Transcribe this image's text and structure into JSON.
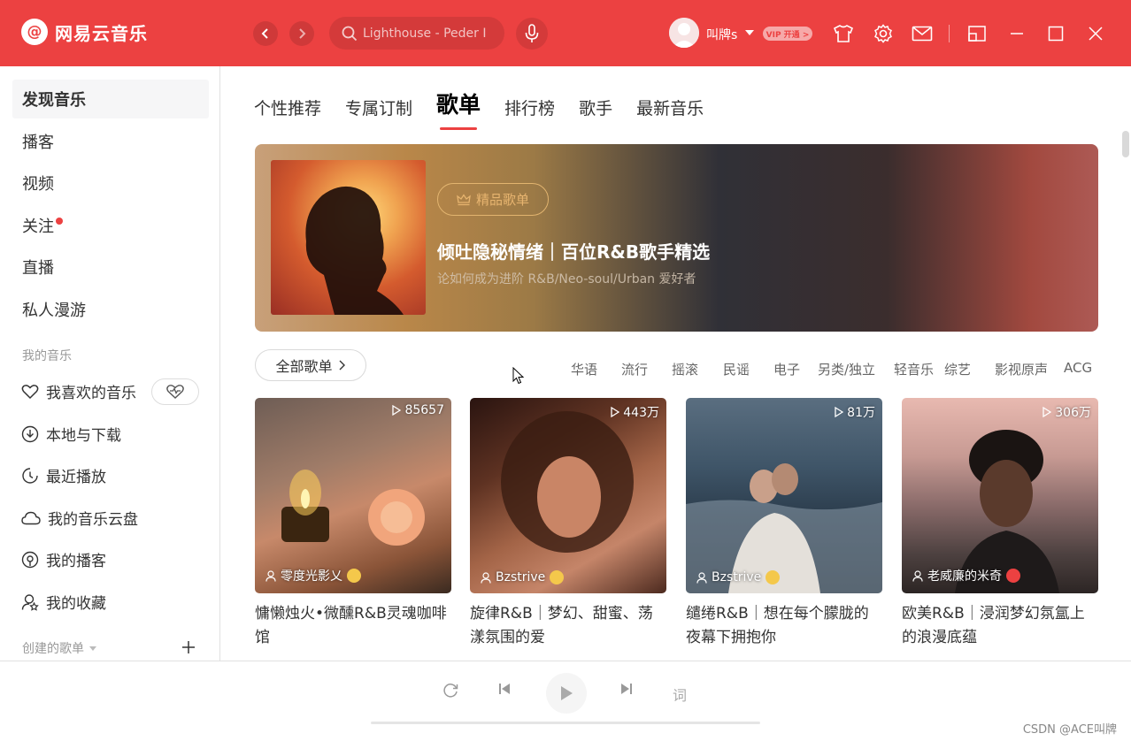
{
  "app": {
    "logo_text": "网易云音乐",
    "logo_mark": "@"
  },
  "header": {
    "search_placeholder": "Lighthouse - Peder I",
    "username": "叫牌s",
    "vip_label": "VIP 开通 >"
  },
  "sidebar": {
    "primary": [
      {
        "label": "发现音乐",
        "active": true
      },
      {
        "label": "播客"
      },
      {
        "label": "视频"
      },
      {
        "label": "关注",
        "dot": true
      },
      {
        "label": "直播"
      },
      {
        "label": "私人漫游"
      }
    ],
    "my_music_heading": "我的音乐",
    "my_music": [
      {
        "label": "我喜欢的音乐",
        "icon": "heart-icon"
      },
      {
        "label": "本地与下载",
        "icon": "download-icon"
      },
      {
        "label": "最近播放",
        "icon": "clock-icon"
      },
      {
        "label": "我的音乐云盘",
        "icon": "cloud-icon"
      },
      {
        "label": "我的播客",
        "icon": "podcast-icon"
      },
      {
        "label": "我的收藏",
        "icon": "collect-icon"
      }
    ],
    "created_heading": "创建的歌单"
  },
  "main": {
    "tabs": [
      "个性推荐",
      "专属订制",
      "歌单",
      "排行榜",
      "歌手",
      "最新音乐"
    ],
    "active_tab": "歌单",
    "banner": {
      "badge": "精品歌单",
      "title": "倾吐隐秘情绪｜百位R&B歌手精选",
      "subtitle": "论如何成为进阶 R&B/Neo-soul/Urban 爱好者"
    },
    "all_button": "全部歌单",
    "categories": [
      "华语",
      "流行",
      "摇滚",
      "民谣",
      "电子",
      "另类/独立",
      "轻音乐",
      "综艺",
      "影视原声",
      "ACG"
    ],
    "cards": [
      {
        "plays": "85657",
        "creator": "零度光影乂",
        "title_line1": "慵懒烛火•微醺R&B灵魂咖啡",
        "title_line2": "馆"
      },
      {
        "plays": "443万",
        "creator": "Bzstrive",
        "title_line1": "旋律R&B｜梦幻、甜蜜、荡",
        "title_line2": "漾氛围的爱"
      },
      {
        "plays": "81万",
        "creator": "Bzstrive",
        "title_line1": "缱绻R&B｜想在每个朦胧的",
        "title_line2": "夜幕下拥抱你"
      },
      {
        "plays": "306万",
        "creator": "老威廉的米奇",
        "title_line1": "欧美R&B｜浸润梦幻氛氲上",
        "title_line2": "的浪漫底蕴"
      }
    ]
  },
  "player": {
    "lyric_label": "词"
  },
  "watermark": "CSDN @ACE叫牌",
  "colors": {
    "brand": "#ec4141",
    "badge_gold": "#e7b46f"
  }
}
